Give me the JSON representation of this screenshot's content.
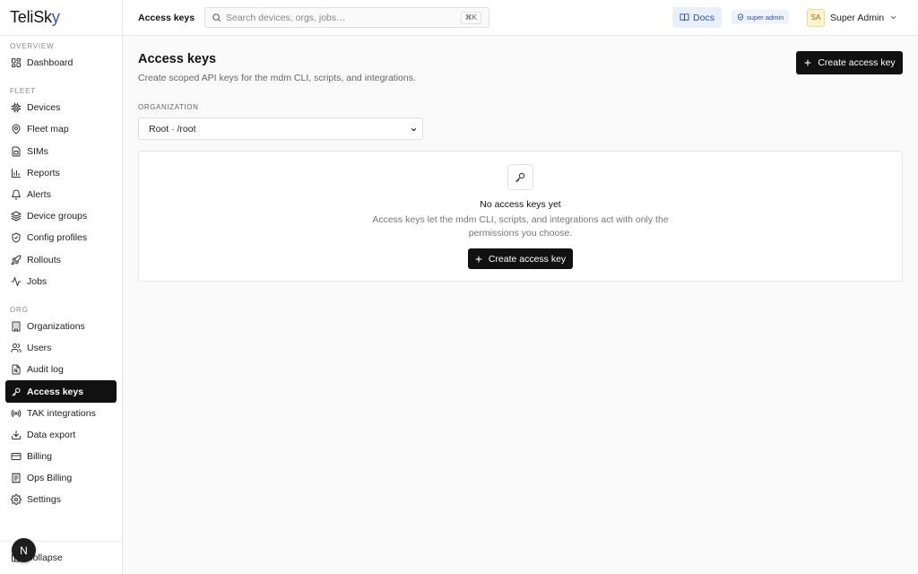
{
  "app": {
    "logo_main": "TeliSk",
    "logo_tail": "y"
  },
  "sidebar": {
    "sections": [
      {
        "label": "OVERVIEW",
        "items": [
          {
            "label": "Dashboard",
            "icon": "dashboard-icon"
          }
        ]
      },
      {
        "label": "FLEET",
        "items": [
          {
            "label": "Devices",
            "icon": "chip-icon"
          },
          {
            "label": "Fleet map",
            "icon": "map-icon"
          },
          {
            "label": "SIMs",
            "icon": "sim-icon"
          },
          {
            "label": "Reports",
            "icon": "bar-chart-icon"
          },
          {
            "label": "Alerts",
            "icon": "bell-icon"
          },
          {
            "label": "Device groups",
            "icon": "layers-icon"
          },
          {
            "label": "Config profiles",
            "icon": "shield-icon"
          },
          {
            "label": "Rollouts",
            "icon": "rocket-icon"
          },
          {
            "label": "Jobs",
            "icon": "activity-icon"
          }
        ]
      },
      {
        "label": "ORG",
        "items": [
          {
            "label": "Organizations",
            "icon": "building-icon"
          },
          {
            "label": "Users",
            "icon": "users-icon"
          },
          {
            "label": "Audit log",
            "icon": "audit-log-icon"
          },
          {
            "label": "Access keys",
            "icon": "key-icon",
            "active": true
          },
          {
            "label": "TAK integrations",
            "icon": "radio-icon"
          },
          {
            "label": "Data export",
            "icon": "download-icon"
          },
          {
            "label": "Billing",
            "icon": "credit-card-icon"
          },
          {
            "label": "Ops Billing",
            "icon": "receipt-icon"
          },
          {
            "label": "Settings",
            "icon": "gear-icon"
          }
        ]
      }
    ],
    "collapse_label": "Collapse",
    "bubble_letter": "N"
  },
  "topbar": {
    "title": "Access keys",
    "search_placeholder": "Search devices, orgs, jobs…",
    "search_shortcut": "⌘K",
    "docs_label": "Docs",
    "role_badge": "super admin",
    "avatar_initials": "SA",
    "user_name": "Super Admin"
  },
  "main": {
    "title": "Access keys",
    "subtitle": "Create scoped API keys for the mdm CLI, scripts, and integrations.",
    "create_button": "Create access key",
    "org_label": "ORGANIZATION",
    "org_selected": "Root · /root",
    "empty": {
      "title": "No access keys yet",
      "description": "Access keys let the mdm CLI, scripts, and integrations act with only the permissions you choose.",
      "button": "Create access key"
    }
  },
  "colors": {
    "accent": "#2f55d4",
    "active_bg": "#111111",
    "docs_bg": "#eaf0fb"
  }
}
